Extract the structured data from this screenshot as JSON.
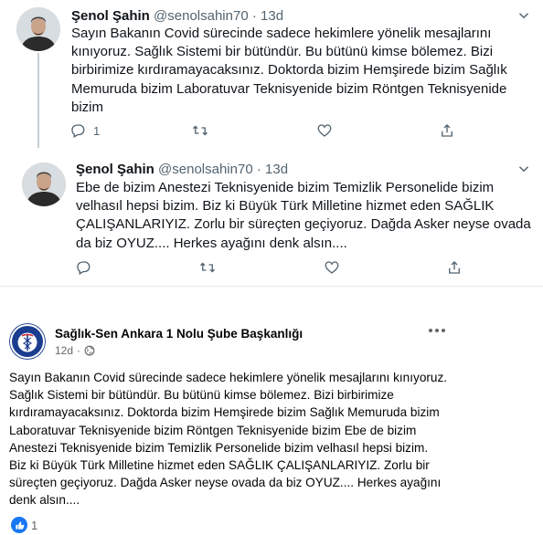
{
  "tweets": [
    {
      "name": "Şenol Şahin",
      "handle": "@senolsahin70",
      "time": "13d",
      "text": "Sayın Bakanın Covid sürecinde sadece hekimlere yönelik mesajlarını kınıyoruz. Sağlık Sistemi bir bütündür. Bu bütünü kimse bölemez. Bizi birbirimize kırdıramayacaksınız. Doktorda bizim Hemşirede bizim Sağlık Memuruda bizim Laboratuvar Teknisyenide bizim Röntgen Teknisyenide bizim",
      "reply_count": "1",
      "retweet_count": "",
      "like_count": ""
    },
    {
      "name": "Şenol Şahin",
      "handle": "@senolsahin70",
      "time": "13d",
      "text": "Ebe de bizim Anestezi Teknisyenide bizim  Temizlik Personelide bizim velhasıl hepsi bizim. Biz ki Büyük Türk Milletine hizmet eden SAĞLIK ÇALIŞANLARIYIZ. Zorlu bir süreçten geçiyoruz. Dağda Asker neyse ovada da biz OYUZ.... Herkes ayağını denk alsın....",
      "reply_count": "",
      "retweet_count": "",
      "like_count": ""
    }
  ],
  "facebook": {
    "page_name": "Sağlık-Sen Ankara 1 Nolu Şube Başkanlığı",
    "time": "12d",
    "visibility_icon": "globe-icon",
    "text": "Sayın Bakanın Covid sürecinde sadece hekimlere yönelik mesajlarını kınıyoruz. Sağlık Sistemi bir bütündür. Bu bütünü kimse bölemez. Bizi birbirimize kırdıramayacaksınız. Doktorda bizim Hemşirede bizim Sağlık Memuruda bizim Laboratuvar Teknisyenide bizim Röntgen Teknisyenide bizim Ebe de bizim Anestezi Teknisyenide bizim Temizlik Personelide bizim velhasıl hepsi bizim. Biz ki Büyük Türk Milletine hizmet eden SAĞLIK ÇALIŞANLARIYIZ. Zorlu bir süreçten geçiyoruz. Dağda Asker neyse ovada da biz OYUZ.... Herkes ayağını denk alsın....",
    "like_count": "1"
  },
  "colors": {
    "twitter_gray": "#536471",
    "facebook_blue": "#1877f2",
    "logo_blue": "#1a3d8f"
  }
}
